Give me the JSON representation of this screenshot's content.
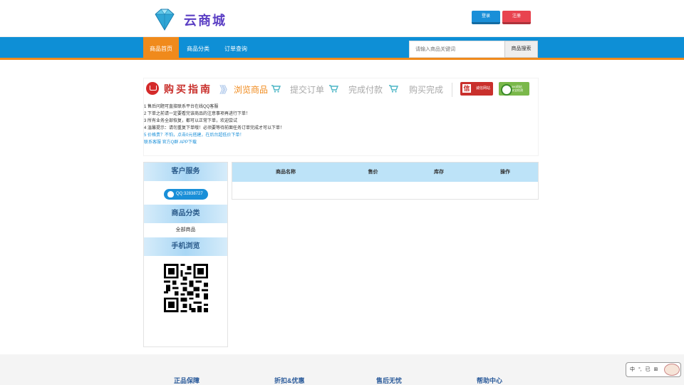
{
  "header": {
    "logo_text": "云商城",
    "login_label": "登录",
    "register_label": "注册"
  },
  "nav": {
    "items": [
      "商品首页",
      "商品分类",
      "订单查询"
    ],
    "search_placeholder": "请输入商品关键词",
    "search_button": "商品搜索"
  },
  "guide": {
    "title": "购买指南",
    "arrows": "》》",
    "steps": [
      "浏览商品",
      "提交订单",
      "完成付款",
      "购买完成"
    ],
    "badge_credit": "诚信网站",
    "badge_360_line1": "360网站",
    "badge_360_line2": "安全检测",
    "notices": [
      "1 售后问题可直接联系平台在线QQ客服",
      "2 下单之前请一定要看完该商品的注意事项再进行下单！",
      "3 所有业务全部恢复，都可以正常下单，欢迎尝试",
      "4 温馨提示：请勿重复下单哦！必须要等待前面任务订单完成才可以下单！",
      "5 价格贵？不怕，点击0元搭建，在后台超低价下单！"
    ],
    "links": "联系客服  官方Q群  APP下载"
  },
  "sidebar": {
    "service_title": "客户服务",
    "qq_label": "QQ:32838727",
    "category_title": "商品分类",
    "all_goods": "全部商品",
    "mobile_title": "手机浏览"
  },
  "goods_table": {
    "columns": [
      "商品名称",
      "售价",
      "库存",
      "操作"
    ]
  },
  "footer": {
    "items": [
      "正品保障",
      "折扣&优惠",
      "售后无忧",
      "帮助中心"
    ]
  },
  "ime": {
    "text": "中 °, 已 ⊞"
  },
  "colors": {
    "nav_blue": "#0e8fd6",
    "accent_orange": "#f08a1c",
    "login_blue": "#1a8fd8",
    "register_red": "#e8434f",
    "guide_red": "#c9302c"
  }
}
